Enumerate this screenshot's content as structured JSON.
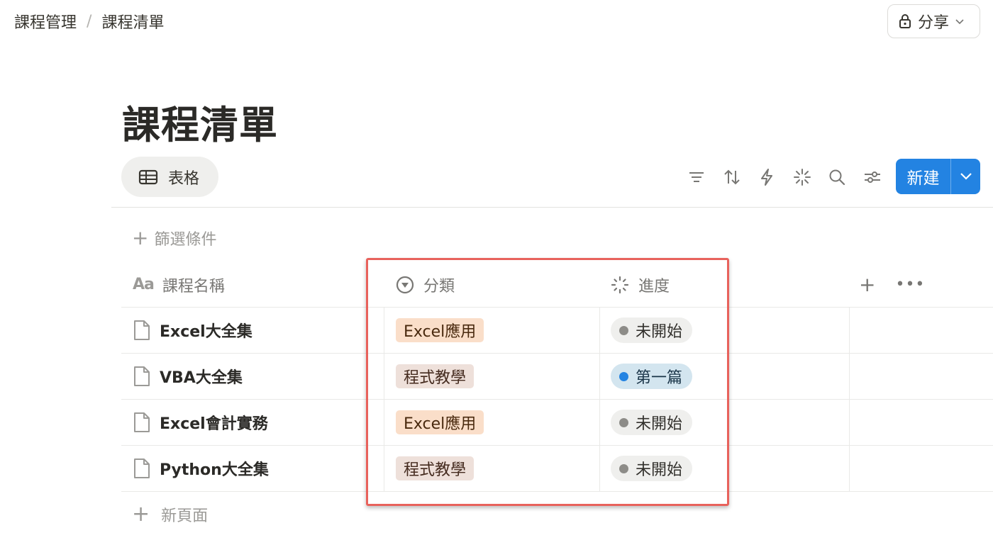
{
  "breadcrumb": {
    "parent": "課程管理",
    "separator": "/",
    "current": "課程清單"
  },
  "share": {
    "label": "分享",
    "icon": "lock-icon"
  },
  "page": {
    "title": "課程清單"
  },
  "view": {
    "label": "表格",
    "icon": "table-icon"
  },
  "toolbar": {
    "icons": [
      "filter-icon",
      "sort-icon",
      "automation-icon",
      "ai-sparkle-icon",
      "search-icon",
      "settings-icon"
    ],
    "new_label": "新建"
  },
  "filter": {
    "add_label": "篩選條件"
  },
  "table": {
    "columns": [
      {
        "label": "課程名稱",
        "icon": "Aa"
      },
      {
        "label": "分類",
        "icon": "select-icon"
      },
      {
        "label": "進度",
        "icon": "status-icon"
      }
    ],
    "rows": [
      {
        "name": "Excel大全集",
        "category": "Excel應用",
        "progress": "未開始"
      },
      {
        "name": "VBA大全集",
        "category": "程式教學",
        "progress": "第一篇"
      },
      {
        "name": "Excel會計實務",
        "category": "Excel應用",
        "progress": "未開始"
      },
      {
        "name": "Python大全集",
        "category": "程式教學",
        "progress": "未開始"
      }
    ],
    "new_page_label": "新頁面"
  },
  "colors": {
    "accent": "#2383e2",
    "highlight": "#e8625c",
    "tag_excel": "#fadec9",
    "tag_prog": "#eee0da",
    "status_none": "#efefed",
    "status_first": "#d3e5ef"
  }
}
